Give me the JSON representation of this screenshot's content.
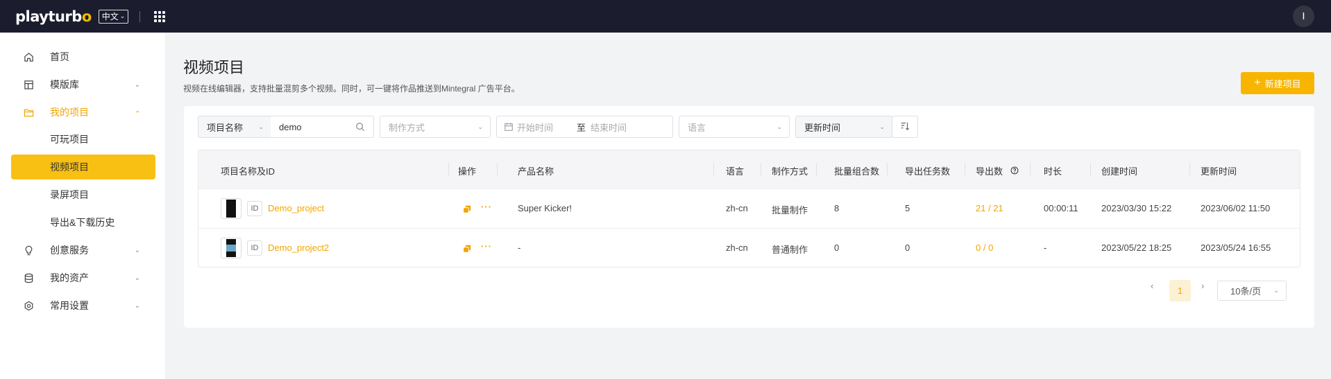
{
  "topbar": {
    "logo_main": "playturb",
    "logo_o": "o",
    "lang": "中文",
    "avatar_initial": "I"
  },
  "sidebar": {
    "items": [
      {
        "label": "首页"
      },
      {
        "label": "模版库"
      },
      {
        "label": "我的项目"
      },
      {
        "label": "可玩项目"
      },
      {
        "label": "视频项目"
      },
      {
        "label": "录屏项目"
      },
      {
        "label": "导出&下载历史"
      },
      {
        "label": "创意服务"
      },
      {
        "label": "我的资产"
      },
      {
        "label": "常用设置"
      }
    ]
  },
  "main": {
    "title": "视频项目",
    "description": "视频在线编辑器，支持批量混剪多个视频。同时，可一键将作品推送到Mintegral 广告平台。",
    "new_button": "新建项目"
  },
  "filters": {
    "name_select": "项目名称",
    "search_value": "demo",
    "method_placeholder": "制作方式",
    "start_placeholder": "开始时间",
    "date_sep": "至",
    "end_placeholder": "结束时间",
    "lang_placeholder": "语言",
    "sort_select": "更新时间"
  },
  "table": {
    "headers": [
      "项目名称及ID",
      "操作",
      "产品名称",
      "语言",
      "制作方式",
      "批量组合数",
      "导出任务数",
      "导出数",
      "时长",
      "创建时间",
      "更新时间"
    ],
    "rows": [
      {
        "id_badge": "ID",
        "name": "Demo_project",
        "product": "Super Kicker!",
        "lang": "zh-cn",
        "method": "批量制作",
        "combos": "8",
        "tasks": "5",
        "exports": "21 / 21",
        "duration": "00:00:11",
        "created": "2023/03/30 15:22",
        "updated": "2023/06/02 11:50"
      },
      {
        "id_badge": "ID",
        "name": "Demo_project2",
        "product": "-",
        "lang": "zh-cn",
        "method": "普通制作",
        "combos": "0",
        "tasks": "0",
        "exports": "0 / 0",
        "duration": "-",
        "created": "2023/05/22 18:25",
        "updated": "2023/05/24 16:55"
      }
    ]
  },
  "pagination": {
    "current": "1",
    "page_size": "10条/页"
  },
  "colors": {
    "accent": "#f8b500",
    "topbar": "#1b1d2e",
    "active_nav": "#f8c012"
  }
}
